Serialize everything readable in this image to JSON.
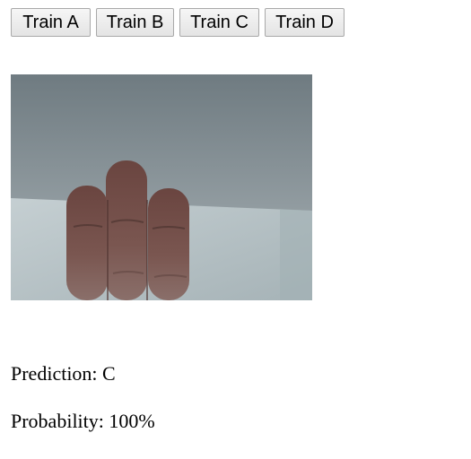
{
  "buttons": [
    {
      "label": "Train A"
    },
    {
      "label": "Train B"
    },
    {
      "label": "Train C"
    },
    {
      "label": "Train D"
    }
  ],
  "webcam": {
    "description_icon": "webcam-feed",
    "colors": {
      "wall_top": "#6f7b81",
      "wall_bottom": "#a9b2b6",
      "floor": "#b8c3c6",
      "skin": "#6b4a44"
    }
  },
  "result": {
    "prediction_label": "Prediction:",
    "prediction_value": "C",
    "probability_label": "Probability:",
    "probability_value": "100%"
  }
}
